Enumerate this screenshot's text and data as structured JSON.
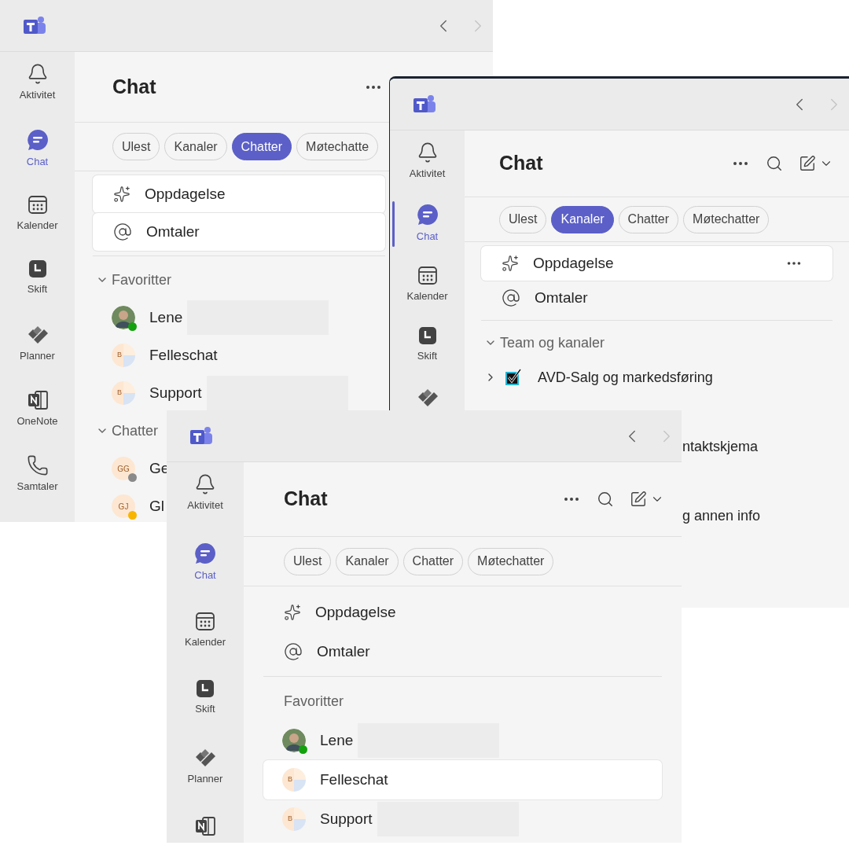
{
  "windows": [
    {
      "nav": [
        {
          "kind": "back",
          "disabled": false
        },
        {
          "kind": "forward",
          "disabled": true
        }
      ],
      "sidebar": [
        {
          "kind": "bell",
          "label": "Aktivitet",
          "selected": false
        },
        {
          "kind": "chat",
          "label": "Chat",
          "selected": true
        },
        {
          "kind": "calendar",
          "label": "Kalender",
          "selected": false
        },
        {
          "kind": "shift",
          "label": "Skift",
          "selected": false
        },
        {
          "kind": "planner",
          "label": "Planner",
          "selected": false
        },
        {
          "kind": "onenote",
          "label": "OneNote",
          "selected": false
        },
        {
          "kind": "phone",
          "label": "Samtaler",
          "selected": false
        }
      ],
      "title": "Chat",
      "actions": [
        {
          "kind": "more"
        }
      ],
      "filters": [
        {
          "label": "Ulest",
          "selected": false
        },
        {
          "label": "Kanaler",
          "selected": false
        },
        {
          "label": "Chatter",
          "selected": true
        },
        {
          "label": "Møtechatte",
          "selected": false
        }
      ],
      "quick": [
        {
          "kind": "discover",
          "label": "Oppdagelse",
          "highlighted": true
        },
        {
          "kind": "mentions",
          "label": "Omtaler",
          "highlighted": true
        }
      ],
      "sections": [
        {
          "title": "Favoritter",
          "expanded": true,
          "items": [
            {
              "kind": "person",
              "color": "#13a10e",
              "name": "Lene",
              "redacted": true,
              "selected": false
            },
            {
              "kind": "group",
              "initials": "B",
              "name": "Felleschat",
              "redacted": false,
              "selected": false
            },
            {
              "kind": "group",
              "initials": "B",
              "name": "Support",
              "redacted": true,
              "selected": false
            }
          ]
        },
        {
          "title": "Chatter",
          "expanded": true,
          "items": [
            {
              "kind": "initials",
              "initials": "GG",
              "color": "#8a8a8a",
              "name": "Ge",
              "redacted": false,
              "selected": false
            },
            {
              "kind": "initials",
              "initials": "GJ",
              "color": "#f7b500",
              "name": "Gl",
              "redacted": false,
              "selected": false
            }
          ]
        }
      ]
    },
    {
      "nav": [
        {
          "kind": "back",
          "disabled": false
        },
        {
          "kind": "forward",
          "disabled": true
        }
      ],
      "sidebar": [
        {
          "kind": "bell",
          "label": "Aktivitet",
          "selected": false
        },
        {
          "kind": "chat",
          "label": "Chat",
          "selected": true
        },
        {
          "kind": "calendar",
          "label": "Kalender",
          "selected": false
        },
        {
          "kind": "shift",
          "label": "Skift",
          "selected": false
        },
        {
          "kind": "planner",
          "selected": false
        }
      ],
      "title": "Chat",
      "actions": [
        {
          "kind": "more"
        },
        {
          "kind": "search"
        },
        {
          "kind": "compose"
        }
      ],
      "filters": [
        {
          "label": "Ulest",
          "selected": false
        },
        {
          "label": "Kanaler",
          "selected": true
        },
        {
          "label": "Chatter",
          "selected": false
        },
        {
          "label": "Møtechatter",
          "selected": false
        }
      ],
      "quick": [
        {
          "kind": "discover",
          "label": "Oppdagelse",
          "highlighted": true,
          "more": true
        },
        {
          "kind": "mentions",
          "label": "Omtaler",
          "highlighted": false
        }
      ],
      "sections": [
        {
          "title": "Team og kanaler",
          "expanded": true,
          "items": [
            {
              "kind": "team",
              "name": "AVD-Salg og markedsføring",
              "expanded": false
            },
            {
              "kind": "covered",
              "name": "ntaktskjema"
            },
            {
              "kind": "covered",
              "name": "g annen info"
            }
          ]
        }
      ]
    },
    {
      "nav": [
        {
          "kind": "back",
          "disabled": false
        },
        {
          "kind": "forward",
          "disabled": true
        }
      ],
      "sidebar": [
        {
          "kind": "bell",
          "label": "Aktivitet",
          "selected": false
        },
        {
          "kind": "chat",
          "label": "Chat",
          "selected": true
        },
        {
          "kind": "calendar",
          "label": "Kalender",
          "selected": false
        },
        {
          "kind": "shift",
          "label": "Skift",
          "selected": false
        },
        {
          "kind": "planner",
          "label": "Planner",
          "selected": false
        },
        {
          "kind": "onenote",
          "selected": false
        }
      ],
      "title": "Chat",
      "actions": [
        {
          "kind": "more"
        },
        {
          "kind": "search"
        },
        {
          "kind": "compose"
        }
      ],
      "filters": [
        {
          "label": "Ulest",
          "selected": false
        },
        {
          "label": "Kanaler",
          "selected": false
        },
        {
          "label": "Chatter",
          "selected": false
        },
        {
          "label": "Møtechatter",
          "selected": false
        }
      ],
      "quick": [
        {
          "kind": "discover",
          "label": "Oppdagelse",
          "highlighted": false
        },
        {
          "kind": "mentions",
          "label": "Omtaler",
          "highlighted": false
        }
      ],
      "sections": [
        {
          "title": "Favoritter",
          "items": [
            {
              "kind": "person",
              "color": "#13a10e",
              "name": "Lene",
              "redacted": true,
              "selected": false
            },
            {
              "kind": "group",
              "initials": "B",
              "name": "Felleschat",
              "redacted": false,
              "selected": true
            },
            {
              "kind": "group",
              "initials": "B",
              "name": "Support",
              "redacted": true,
              "selected": false
            }
          ]
        }
      ]
    }
  ]
}
